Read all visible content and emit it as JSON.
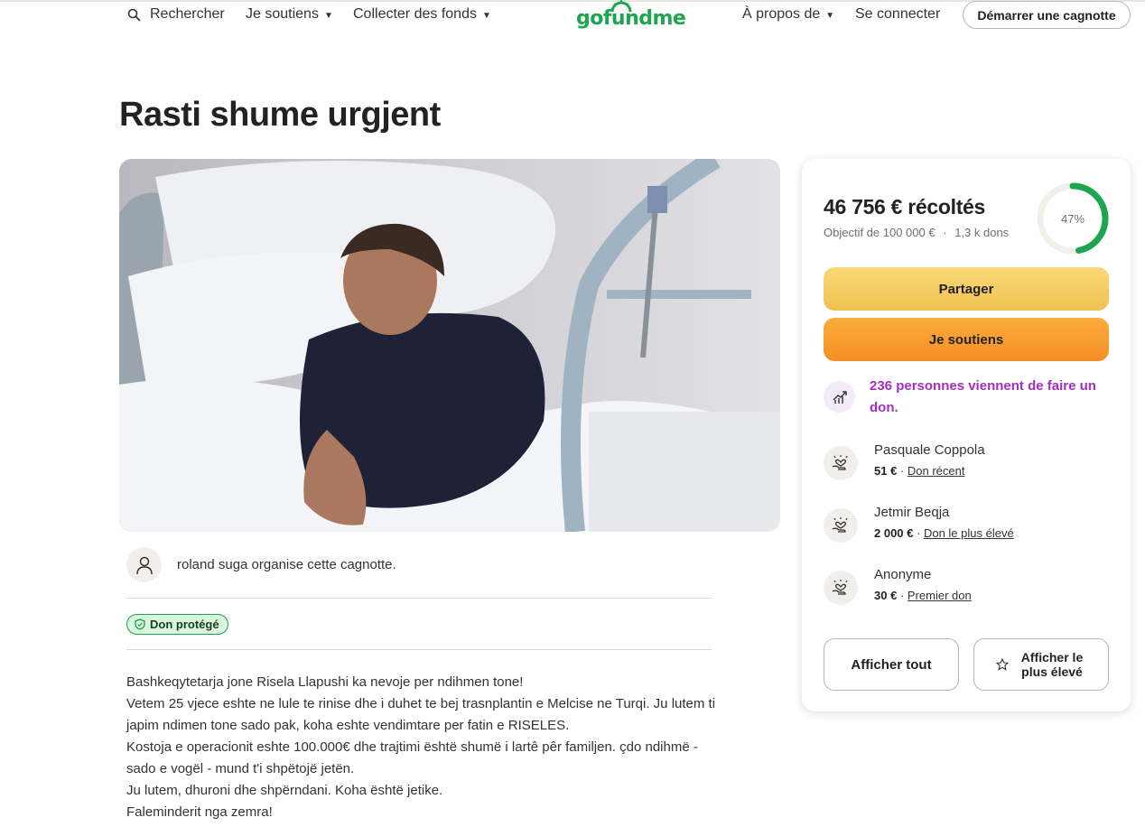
{
  "header": {
    "search_label": "Rechercher",
    "support_label": "Je soutiens",
    "fundraise_label": "Collecter des fonds",
    "logo_text": "gofundme",
    "about_label": "À propos de",
    "login_label": "Se connecter",
    "start_label": "Démarrer une cagnotte"
  },
  "campaign": {
    "title": "Rasti shume urgjent",
    "organizer_text": "roland suga organise cette cagnotte.",
    "protected_label": "Don protégé",
    "story": [
      "Bashkeqytetarja jone Risela Llapushi ka nevoje per ndihmen tone!",
      "Vetem 25 vjece eshte ne lule te rinise dhe i duhet te bej trasnplantin e Melcise ne Turqi. Ju lutem ti japim ndimen tone sado pak, koha eshte vendimtare per fatin e RISELES.",
      "Kostoja e operacionit eshte 100.000€ dhe trajtimi është shumë i lartê pêr familjen. çdo ndihmë - sado e vogël - mund t'i shpëtojë jetën.",
      "Ju lutem, dhuroni dhe shpërndani. Koha është jetike.",
      "Faleminderit nga zemra!"
    ]
  },
  "donation_card": {
    "raised_text": "46 756 € récoltés",
    "goal_text": "Objectif de 100 000 €",
    "donations_count": "1,3 k dons",
    "percent_label": "47%",
    "percent_value": 0.47,
    "share_label": "Partager",
    "donate_label": "Je soutiens",
    "recent_text": "236 personnes viennent de faire un don.",
    "donors": [
      {
        "name": "Pasquale Coppola",
        "amount": "51 €",
        "tag": "Don récent"
      },
      {
        "name": "Jetmir Beqja",
        "amount": "2 000 €",
        "tag": "Don le plus élevé"
      },
      {
        "name": "Anonyme",
        "amount": "30 €",
        "tag": "Premier don"
      }
    ],
    "see_all_label": "Afficher tout",
    "see_top_label": "Afficher le plus élevé"
  },
  "colors": {
    "brand_green": "#1ea54f",
    "share_yellow": "#f2c14e",
    "donate_orange": "#f48f24",
    "recent_purple": "#a62ec4"
  },
  "icons": [
    "search-icon",
    "chevron-down-icon",
    "user-icon",
    "shield-icon",
    "trend-icon",
    "heart-hand-icon",
    "star-icon"
  ]
}
